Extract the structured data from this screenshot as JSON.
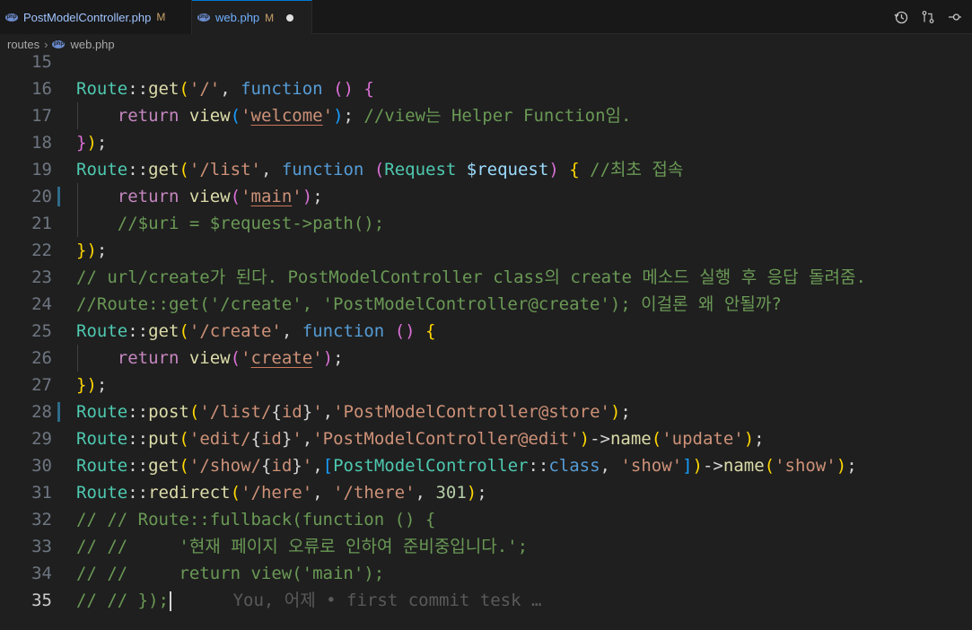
{
  "tabs": [
    {
      "name": "PostModelController.php",
      "badge": "php",
      "status": "M",
      "active": false
    },
    {
      "name": "web.php",
      "badge": "php",
      "status": "M",
      "active": true,
      "unsaved": true
    }
  ],
  "toolbar_icons": [
    "history-icon",
    "source-control-compare-icon",
    "revert-icon"
  ],
  "breadcrumb": {
    "folder": "routes",
    "file": "web.php"
  },
  "editor": {
    "current_line": "35",
    "lines": [
      {
        "n": "15",
        "tokens": []
      },
      {
        "n": "16",
        "tokens": [
          {
            "c": "cls",
            "t": "Route"
          },
          {
            "c": "op",
            "t": "::"
          },
          {
            "c": "fn",
            "t": "get"
          },
          {
            "c": "br1",
            "t": "("
          },
          {
            "c": "str",
            "t": "'/'"
          },
          {
            "c": "op",
            "t": ", "
          },
          {
            "c": "kw",
            "t": "function"
          },
          {
            "c": "op",
            "t": " "
          },
          {
            "c": "br2",
            "t": "()"
          },
          {
            "c": "op",
            "t": " "
          },
          {
            "c": "br2",
            "t": "{"
          }
        ]
      },
      {
        "n": "17",
        "tokens": [
          {
            "c": "op",
            "t": "    "
          },
          {
            "c": "ret",
            "t": "return"
          },
          {
            "c": "op",
            "t": " "
          },
          {
            "c": "fn",
            "t": "view"
          },
          {
            "c": "br3",
            "t": "("
          },
          {
            "c": "str",
            "t": "'"
          },
          {
            "c": "str ul",
            "t": "welcome"
          },
          {
            "c": "str",
            "t": "'"
          },
          {
            "c": "br3",
            "t": ")"
          },
          {
            "c": "op",
            "t": "; "
          },
          {
            "c": "cmt",
            "t": "//view는 Helper Function임."
          }
        ]
      },
      {
        "n": "18",
        "tokens": [
          {
            "c": "br2",
            "t": "}"
          },
          {
            "c": "br1",
            "t": ")"
          },
          {
            "c": "op",
            "t": ";"
          }
        ]
      },
      {
        "n": "19",
        "tokens": [
          {
            "c": "cls",
            "t": "Route"
          },
          {
            "c": "op",
            "t": "::"
          },
          {
            "c": "fn",
            "t": "get"
          },
          {
            "c": "br1",
            "t": "("
          },
          {
            "c": "str",
            "t": "'/list'"
          },
          {
            "c": "op",
            "t": ", "
          },
          {
            "c": "kw",
            "t": "function"
          },
          {
            "c": "op",
            "t": " "
          },
          {
            "c": "br2",
            "t": "("
          },
          {
            "c": "cls",
            "t": "Request"
          },
          {
            "c": "op",
            "t": " "
          },
          {
            "c": "var",
            "t": "$request"
          },
          {
            "c": "br2",
            "t": ")"
          },
          {
            "c": "op",
            "t": " "
          },
          {
            "c": "br1",
            "t": "{"
          },
          {
            "c": "op",
            "t": " "
          },
          {
            "c": "cmt",
            "t": "//최초 접속"
          }
        ]
      },
      {
        "n": "20",
        "mark": true,
        "tokens": [
          {
            "c": "op",
            "t": "    "
          },
          {
            "c": "ret",
            "t": "return"
          },
          {
            "c": "op",
            "t": " "
          },
          {
            "c": "fn",
            "t": "view"
          },
          {
            "c": "br2",
            "t": "("
          },
          {
            "c": "str",
            "t": "'"
          },
          {
            "c": "str ul",
            "t": "main"
          },
          {
            "c": "str",
            "t": "'"
          },
          {
            "c": "br2",
            "t": ")"
          },
          {
            "c": "op",
            "t": ";"
          }
        ]
      },
      {
        "n": "21",
        "tokens": [
          {
            "c": "op",
            "t": "    "
          },
          {
            "c": "cmt",
            "t": "//$uri = $request->path();"
          }
        ]
      },
      {
        "n": "22",
        "tokens": [
          {
            "c": "br1",
            "t": "}"
          },
          {
            "c": "br1",
            "t": ")"
          },
          {
            "c": "op",
            "t": ";"
          }
        ]
      },
      {
        "n": "23",
        "tokens": [
          {
            "c": "cmt",
            "t": "// url/create가 된다. PostModelController class의 create 메소드 실행 후 응답 돌려줌."
          }
        ]
      },
      {
        "n": "24",
        "tokens": [
          {
            "c": "cmt",
            "t": "//Route::get('/create', 'PostModelController@create'); 이걸론 왜 안될까?"
          }
        ]
      },
      {
        "n": "25",
        "tokens": [
          {
            "c": "cls",
            "t": "Route"
          },
          {
            "c": "op",
            "t": "::"
          },
          {
            "c": "fn",
            "t": "get"
          },
          {
            "c": "br1",
            "t": "("
          },
          {
            "c": "str",
            "t": "'/create'"
          },
          {
            "c": "op",
            "t": ", "
          },
          {
            "c": "kw",
            "t": "function"
          },
          {
            "c": "op",
            "t": " "
          },
          {
            "c": "br2",
            "t": "()"
          },
          {
            "c": "op",
            "t": " "
          },
          {
            "c": "br1",
            "t": "{"
          }
        ]
      },
      {
        "n": "26",
        "tokens": [
          {
            "c": "op",
            "t": "    "
          },
          {
            "c": "ret",
            "t": "return"
          },
          {
            "c": "op",
            "t": " "
          },
          {
            "c": "fn",
            "t": "view"
          },
          {
            "c": "br2",
            "t": "("
          },
          {
            "c": "str",
            "t": "'"
          },
          {
            "c": "str ul",
            "t": "create"
          },
          {
            "c": "str",
            "t": "'"
          },
          {
            "c": "br2",
            "t": ")"
          },
          {
            "c": "op",
            "t": ";"
          }
        ]
      },
      {
        "n": "27",
        "tokens": [
          {
            "c": "br1",
            "t": "}"
          },
          {
            "c": "br1",
            "t": ")"
          },
          {
            "c": "op",
            "t": ";"
          }
        ]
      },
      {
        "n": "28",
        "mark": true,
        "tokens": [
          {
            "c": "cls",
            "t": "Route"
          },
          {
            "c": "op",
            "t": "::"
          },
          {
            "c": "fn",
            "t": "post"
          },
          {
            "c": "br1",
            "t": "("
          },
          {
            "c": "str",
            "t": "'/list/"
          },
          {
            "c": "op",
            "t": "{"
          },
          {
            "c": "str",
            "t": "id"
          },
          {
            "c": "op",
            "t": "}"
          },
          {
            "c": "str",
            "t": "'"
          },
          {
            "c": "op",
            "t": ","
          },
          {
            "c": "str",
            "t": "'PostModelController@store'"
          },
          {
            "c": "br1",
            "t": ")"
          },
          {
            "c": "op",
            "t": ";"
          }
        ]
      },
      {
        "n": "29",
        "tokens": [
          {
            "c": "cls",
            "t": "Route"
          },
          {
            "c": "op",
            "t": "::"
          },
          {
            "c": "fn",
            "t": "put"
          },
          {
            "c": "br1",
            "t": "("
          },
          {
            "c": "str",
            "t": "'edit/"
          },
          {
            "c": "op",
            "t": "{"
          },
          {
            "c": "str",
            "t": "id"
          },
          {
            "c": "op",
            "t": "}"
          },
          {
            "c": "str",
            "t": "'"
          },
          {
            "c": "op",
            "t": ","
          },
          {
            "c": "str",
            "t": "'PostModelController@edit'"
          },
          {
            "c": "br1",
            "t": ")"
          },
          {
            "c": "op",
            "t": "->"
          },
          {
            "c": "fn",
            "t": "name"
          },
          {
            "c": "br1",
            "t": "("
          },
          {
            "c": "str",
            "t": "'update'"
          },
          {
            "c": "br1",
            "t": ")"
          },
          {
            "c": "op",
            "t": ";"
          }
        ]
      },
      {
        "n": "30",
        "tokens": [
          {
            "c": "cls",
            "t": "Route"
          },
          {
            "c": "op",
            "t": "::"
          },
          {
            "c": "fn",
            "t": "get"
          },
          {
            "c": "br1",
            "t": "("
          },
          {
            "c": "str",
            "t": "'/show/"
          },
          {
            "c": "op",
            "t": "{"
          },
          {
            "c": "str",
            "t": "id"
          },
          {
            "c": "op",
            "t": "}"
          },
          {
            "c": "str",
            "t": "'"
          },
          {
            "c": "op",
            "t": ","
          },
          {
            "c": "br3",
            "t": "["
          },
          {
            "c": "cls",
            "t": "PostModelController"
          },
          {
            "c": "op",
            "t": "::"
          },
          {
            "c": "kw",
            "t": "class"
          },
          {
            "c": "op",
            "t": ", "
          },
          {
            "c": "str",
            "t": "'show'"
          },
          {
            "c": "br3",
            "t": "]"
          },
          {
            "c": "br1",
            "t": ")"
          },
          {
            "c": "op",
            "t": "->"
          },
          {
            "c": "fn",
            "t": "name"
          },
          {
            "c": "br1",
            "t": "("
          },
          {
            "c": "str",
            "t": "'show'"
          },
          {
            "c": "br1",
            "t": ")"
          },
          {
            "c": "op",
            "t": ";"
          }
        ]
      },
      {
        "n": "31",
        "tokens": [
          {
            "c": "cls",
            "t": "Route"
          },
          {
            "c": "op",
            "t": "::"
          },
          {
            "c": "fn",
            "t": "redirect"
          },
          {
            "c": "br1",
            "t": "("
          },
          {
            "c": "str",
            "t": "'/here'"
          },
          {
            "c": "op",
            "t": ", "
          },
          {
            "c": "str",
            "t": "'/there'"
          },
          {
            "c": "op",
            "t": ", "
          },
          {
            "c": "num",
            "t": "301"
          },
          {
            "c": "br1",
            "t": ")"
          },
          {
            "c": "op",
            "t": ";"
          }
        ]
      },
      {
        "n": "32",
        "tokens": [
          {
            "c": "cmt",
            "t": "// // Route::fullback(function () {"
          }
        ]
      },
      {
        "n": "33",
        "tokens": [
          {
            "c": "cmt",
            "t": "// //     '현재 페이지 오류로 인하여 준비중입니다.';"
          }
        ]
      },
      {
        "n": "34",
        "tokens": [
          {
            "c": "cmt",
            "t": "// //     return view('main');"
          }
        ]
      },
      {
        "n": "35",
        "cursor": true,
        "tokens": [
          {
            "c": "cmt",
            "t": "// // });"
          }
        ],
        "blame": "      You, 어제 • first commit tesk …"
      }
    ]
  }
}
